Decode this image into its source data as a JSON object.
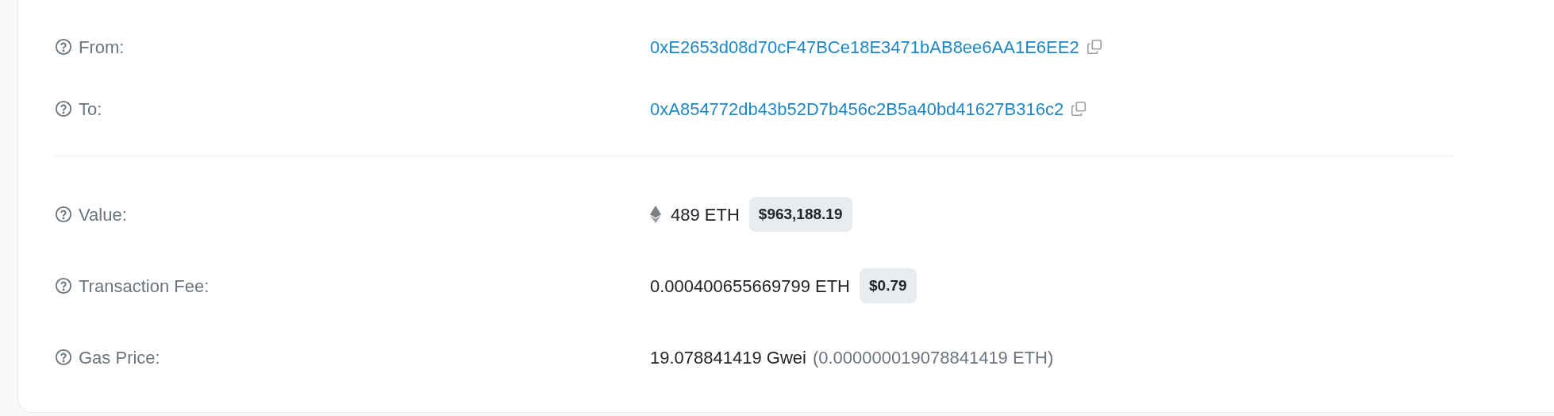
{
  "sections": [
    {
      "rows": [
        {
          "kind": "address",
          "label": "From:",
          "value": "0xE2653d08d70cF47BCe18E3471bAB8ee6AA1E6EE2"
        },
        {
          "kind": "address",
          "label": "To:",
          "value": "0xA854772db43b52D7b456c2B5a40bd41627B316c2"
        }
      ]
    },
    {
      "rows": [
        {
          "kind": "ether",
          "label": "Value:",
          "value": "489 ETH",
          "badge": "$963,188.19"
        },
        {
          "kind": "amount",
          "label": "Transaction Fee:",
          "value": "0.000400655669799 ETH",
          "badge": "$0.79"
        },
        {
          "kind": "gas",
          "label": "Gas Price:",
          "value": "19.078841419 Gwei",
          "note": "(0.000000019078841419 ETH)"
        }
      ]
    }
  ]
}
